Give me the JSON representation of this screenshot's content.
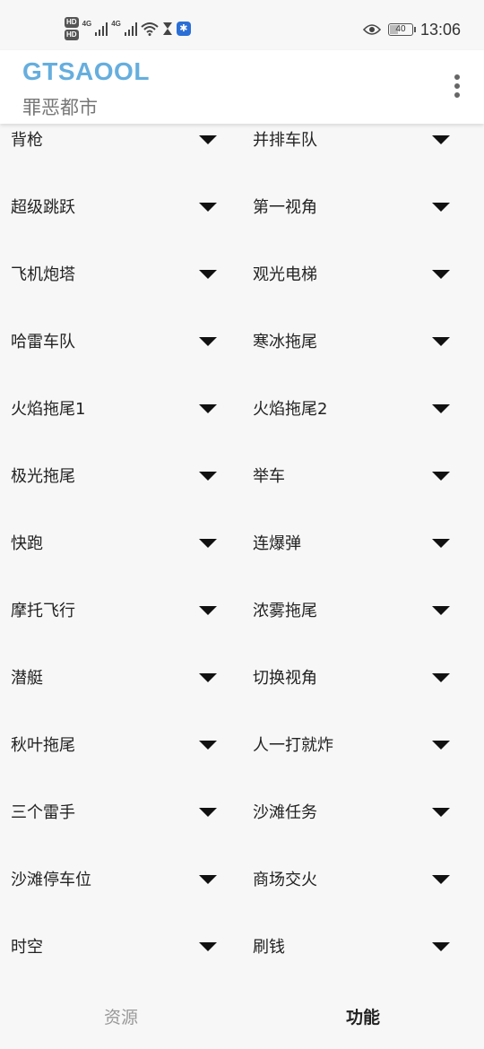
{
  "status_bar": {
    "hd1": "HD",
    "hd2": "HD",
    "net1": "4G",
    "net2": "4G",
    "battery": "40",
    "battery_level": 0.4,
    "time": "13:06",
    "icons": [
      "signal-icon",
      "wifi-icon",
      "hourglass-icon",
      "app-notification-icon",
      "eye-icon",
      "battery-icon"
    ]
  },
  "app_bar": {
    "title": "GTSAOOL",
    "subtitle": "罪恶都市",
    "title_color": "#66aede"
  },
  "items": [
    [
      "背枪",
      "并排车队"
    ],
    [
      "超级跳跃",
      "第一视角"
    ],
    [
      "飞机炮塔",
      "观光电梯"
    ],
    [
      "哈雷车队",
      "寒冰拖尾"
    ],
    [
      "火焰拖尾1",
      "火焰拖尾2"
    ],
    [
      "极光拖尾",
      "举车"
    ],
    [
      "快跑",
      "连爆弹"
    ],
    [
      "摩托飞行",
      "浓雾拖尾"
    ],
    [
      "潜艇",
      "切换视角"
    ],
    [
      "秋叶拖尾",
      "人一打就炸"
    ],
    [
      "三个雷手",
      "沙滩任务"
    ],
    [
      "沙滩停车位",
      "商场交火"
    ],
    [
      "时空",
      "刷钱"
    ]
  ],
  "bottom_nav": {
    "tab1": "资源",
    "tab2": "功能",
    "active_tab": "功能"
  }
}
